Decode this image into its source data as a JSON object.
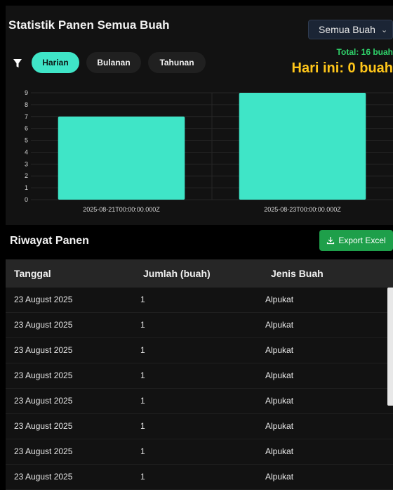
{
  "header": {
    "title": "Statistik Panen Semua Buah",
    "select_value": "Semua Buah"
  },
  "tabs": [
    {
      "label": "Harian",
      "active": true
    },
    {
      "label": "Bulanan",
      "active": false
    },
    {
      "label": "Tahunan",
      "active": false
    }
  ],
  "summary": {
    "total": "Total: 16 buah",
    "today": "Hari ini: 0 buah"
  },
  "colors": {
    "accent": "#3fe5c7",
    "total": "#2fd36a",
    "today": "#ffc61a",
    "export": "#1e9f4a"
  },
  "chart_data": {
    "type": "bar",
    "categories": [
      "2025-08-21T00:00:00.000Z",
      "2025-08-23T00:00:00.000Z"
    ],
    "values": [
      7,
      9
    ],
    "ylim": [
      0,
      9
    ],
    "yticks": [
      0,
      1,
      2,
      3,
      4,
      5,
      6,
      7,
      8,
      9
    ],
    "grid": true
  },
  "history": {
    "title": "Riwayat Panen",
    "export_label": "Export Excel",
    "columns": [
      "Tanggal",
      "Jumlah (buah)",
      "Jenis Buah"
    ],
    "rows": [
      [
        "23 August 2025",
        "1",
        "Alpukat"
      ],
      [
        "23 August 2025",
        "1",
        "Alpukat"
      ],
      [
        "23 August 2025",
        "1",
        "Alpukat"
      ],
      [
        "23 August 2025",
        "1",
        "Alpukat"
      ],
      [
        "23 August 2025",
        "1",
        "Alpukat"
      ],
      [
        "23 August 2025",
        "1",
        "Alpukat"
      ],
      [
        "23 August 2025",
        "1",
        "Alpukat"
      ],
      [
        "23 August 2025",
        "1",
        "Alpukat"
      ]
    ]
  }
}
